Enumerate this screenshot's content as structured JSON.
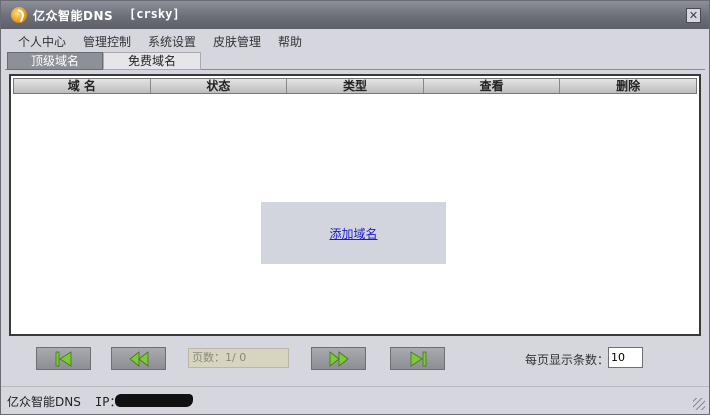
{
  "window": {
    "title": "亿众智能DNS",
    "user_tag": "[crsky]",
    "close_glyph": "✕"
  },
  "menu": [
    {
      "label": "个人中心"
    },
    {
      "label": "管理控制"
    },
    {
      "label": "系统设置"
    },
    {
      "label": "皮肤管理"
    },
    {
      "label": "帮助"
    }
  ],
  "tabs": [
    {
      "label": "顶级域名",
      "active": true
    },
    {
      "label": "免费域名",
      "active": false
    }
  ],
  "table": {
    "columns": [
      "域 名",
      "状态",
      "类型",
      "查看",
      "删除"
    ]
  },
  "add_domain_link": "添加域名",
  "pager": {
    "page_info": "页数：1/ 0",
    "per_page_label": "每页显示条数：",
    "per_page_value": "10",
    "icons": [
      "first-page-icon",
      "prev-page-icon",
      "next-page-icon",
      "last-page-icon"
    ],
    "icon_color": "#7ec83a"
  },
  "status": {
    "app_name": "亿众智能DNS",
    "ip_label": "IP："
  }
}
